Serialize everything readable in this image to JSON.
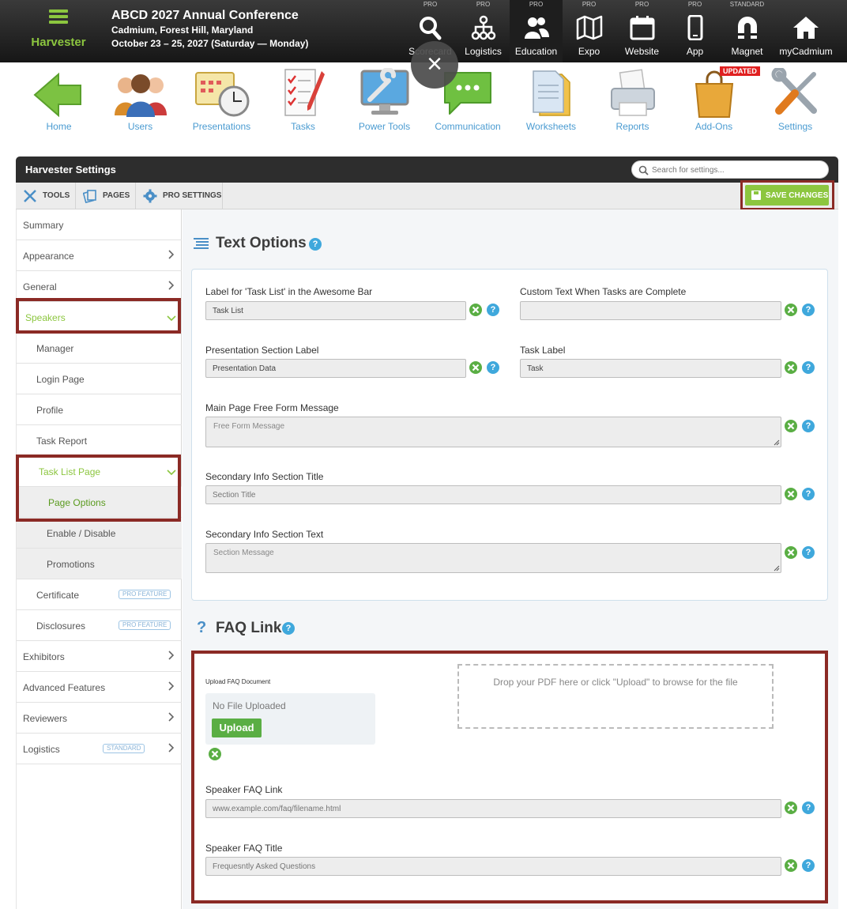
{
  "brand": {
    "name": "Harvester"
  },
  "conference": {
    "title": "ABCD 2027 Annual Conference",
    "location": "Cadmium, Forest Hill, Maryland",
    "dates": "October 23 – 25, 2027 (Saturday — Monday)"
  },
  "topnav": [
    {
      "tier": "PRO",
      "label": "Scorecard",
      "icon": "search-icon"
    },
    {
      "tier": "PRO",
      "label": "Logistics",
      "icon": "org-chart-icon"
    },
    {
      "tier": "PRO",
      "label": "Education",
      "icon": "people-icon"
    },
    {
      "tier": "PRO",
      "label": "Expo",
      "icon": "map-icon"
    },
    {
      "tier": "PRO",
      "label": "Website",
      "icon": "calendar-icon"
    },
    {
      "tier": "PRO",
      "label": "App",
      "icon": "phone-icon"
    },
    {
      "tier": "STANDARD",
      "label": "Magnet",
      "icon": "magnet-icon"
    },
    {
      "tier": "",
      "label": "myCadmium",
      "icon": "home-icon"
    }
  ],
  "overlay": {
    "close_glyph": "×"
  },
  "apps": [
    {
      "label": "Home",
      "icon": "arrow-left-icon"
    },
    {
      "label": "Users",
      "icon": "users-icon"
    },
    {
      "label": "Presentations",
      "icon": "calendar-clock-icon"
    },
    {
      "label": "Tasks",
      "icon": "checklist-icon"
    },
    {
      "label": "Power Tools",
      "icon": "monitor-wrench-icon"
    },
    {
      "label": "Communication",
      "icon": "chat-bubble-icon"
    },
    {
      "label": "Worksheets",
      "icon": "folders-icon"
    },
    {
      "label": "Reports",
      "icon": "printer-icon"
    },
    {
      "label": "Add-Ons",
      "icon": "shopping-bag-icon",
      "badge": "UPDATED"
    },
    {
      "label": "Settings",
      "icon": "tools-icon"
    }
  ],
  "panel": {
    "title": "Harvester Settings",
    "search_placeholder": "Search for settings..."
  },
  "toolbar": {
    "tools_label": "TOOLS",
    "pages_label": "PAGES",
    "pro_settings_label": "PRO SETTINGS",
    "save_label": "SAVE CHANGES"
  },
  "sidebar": {
    "items": [
      {
        "label": "Summary"
      },
      {
        "label": "Appearance"
      },
      {
        "label": "General"
      },
      {
        "label": "Speakers"
      },
      {
        "label": "Manager"
      },
      {
        "label": "Login Page"
      },
      {
        "label": "Profile"
      },
      {
        "label": "Task Report"
      },
      {
        "label": "Task List Page"
      },
      {
        "label": "Page Options"
      },
      {
        "label": "Enable / Disable"
      },
      {
        "label": "Promotions"
      },
      {
        "label": "Certificate",
        "badge": "PRO FEATURE"
      },
      {
        "label": "Disclosures",
        "badge": "PRO FEATURE"
      },
      {
        "label": "Exhibitors"
      },
      {
        "label": "Advanced Features"
      },
      {
        "label": "Reviewers"
      },
      {
        "label": "Logistics",
        "badge": "STANDARD"
      }
    ]
  },
  "text_options": {
    "title": "Text Options",
    "help_glyph": "?",
    "fields": {
      "task_list_label": {
        "label": "Label for 'Task List' in the Awesome Bar",
        "value": "Task List"
      },
      "custom_complete": {
        "label": "Custom Text When Tasks are Complete",
        "value": ""
      },
      "presentation_section": {
        "label": "Presentation Section Label",
        "value": "Presentation Data"
      },
      "task_label": {
        "label": "Task Label",
        "value": "Task"
      },
      "main_free_form": {
        "label": "Main Page Free Form Message",
        "placeholder": "Free Form Message"
      },
      "secondary_title": {
        "label": "Secondary Info Section Title",
        "placeholder": "Section Title"
      },
      "secondary_text": {
        "label": "Secondary Info Section Text",
        "placeholder": "Section Message"
      }
    }
  },
  "faq": {
    "title": "FAQ Link",
    "title_glyph": "?",
    "upload_label": "Upload FAQ Document",
    "upload_status": "No File Uploaded",
    "upload_button": "Upload",
    "dropzone_text": "Drop your PDF here or click \"Upload\" to browse for the file",
    "faq_link": {
      "label": "Speaker FAQ Link",
      "placeholder": "www.example.com/faq/filename.html"
    },
    "faq_title": {
      "label": "Speaker FAQ Title",
      "placeholder": "Frequesntly Asked Questions"
    }
  },
  "colors": {
    "accent_green": "#8cc63f",
    "link_blue": "#4a9bd1",
    "highlight_red": "#8b2a25",
    "help_blue": "#3fa8dc"
  }
}
